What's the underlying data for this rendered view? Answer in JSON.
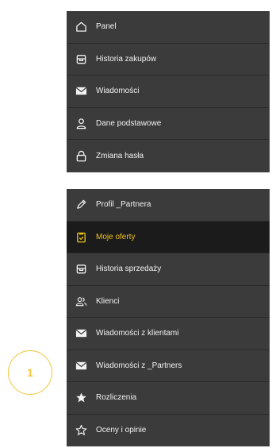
{
  "colors": {
    "menu_bg": "#3b3b3b",
    "active_bg": "#1b1b1b",
    "accent": "#f0c419",
    "text": "#f2f2f2"
  },
  "top_menu": {
    "items": [
      {
        "label": "Panel",
        "icon": "home-icon"
      },
      {
        "label": "Historia zakupów",
        "icon": "box-icon"
      },
      {
        "label": "Wiadomości",
        "icon": "envelope-icon"
      },
      {
        "label": "Dane podstawowe",
        "icon": "user-icon"
      },
      {
        "label": "Zmiana hasła",
        "icon": "lock-icon"
      }
    ]
  },
  "bottom_menu": {
    "items": [
      {
        "label": "Profil _Partnera",
        "icon": "pencil-icon"
      },
      {
        "label": "Moje oferty",
        "icon": "clipboard-check-icon",
        "active": true
      },
      {
        "label": "Historia sprzedaży",
        "icon": "box-icon"
      },
      {
        "label": "Klienci",
        "icon": "users-icon"
      },
      {
        "label": "Wiadomości z klientami",
        "icon": "envelope-icon"
      },
      {
        "label": "Wiadomości z _Partners",
        "icon": "envelope-icon"
      },
      {
        "label": "Rozliczenia",
        "icon": "star-filled-icon"
      },
      {
        "label": "Oceny i opinie",
        "icon": "star-outline-icon"
      }
    ]
  },
  "callout": {
    "number": "1"
  }
}
